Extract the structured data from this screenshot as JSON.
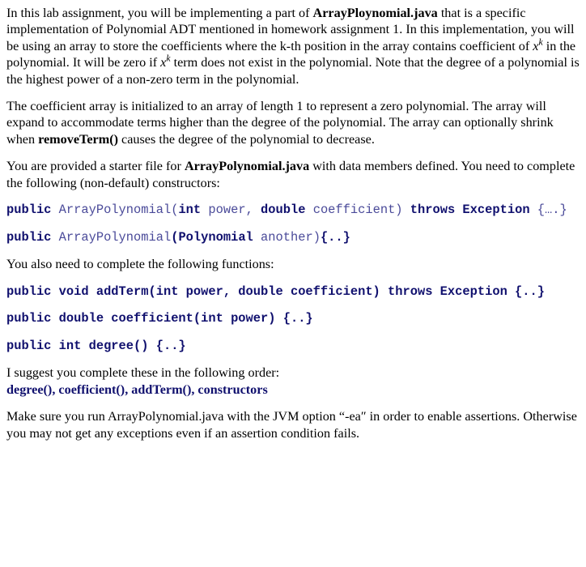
{
  "document": {
    "paragraph_1": {
      "part_1": "In this lab assignment, you will be implementing a part of ",
      "emphasis_1": "ArrayPloynomial.java",
      "part_2": " that is a specific implementation of Polynomial ADT mentioned in homework assignment 1. In this implementation, you will be using an array to store the coefficients where the k-th position in the array contains coefficient of ",
      "math_1_base": "x",
      "math_1_exp": "k",
      "part_3": " in the polynomial. It will be zero if ",
      "math_2_base": "x",
      "math_2_exp": "k",
      "part_4": " term does not exist in the polynomial. Note that the degree of a polynomial is the highest power of a non-zero term in the polynomial."
    },
    "paragraph_2": {
      "part_1": "The coefficient array is initialized to an array of length 1 to represent a zero polynomial. The array will expand to accommodate terms higher than the degree of the polynomial. The array can optionally shrink when ",
      "emphasis_1": "removeTerm()",
      "part_2": " causes the degree of the polynomial to decrease."
    },
    "paragraph_3": {
      "part_1": "You are provided a starter file for ",
      "emphasis_1": "ArrayPolynomial.java",
      "part_2": " with data members defined. You need to complete the following (non-default) constructors:"
    },
    "code_1": {
      "seg_1": "public",
      "seg_2": " ArrayPolynomial(",
      "seg_3": "int",
      "seg_4": " power, ",
      "seg_5": "double",
      "seg_6": " coefficient) ",
      "seg_7": "throws Exception",
      "seg_8": " {….}"
    },
    "code_2": {
      "seg_1": "public",
      "seg_2": " ArrayPolynomial",
      "seg_3": "(Polynomial",
      "seg_4": " another)",
      "seg_5": "{..}"
    },
    "paragraph_4": {
      "part_1": "You also need to complete the following functions:"
    },
    "code_3": {
      "seg_1": "public void addTerm(int power, double coefficient) throws Exception {..}"
    },
    "code_4": {
      "seg_1": "public double coefficient(int power) {..}"
    },
    "code_5": {
      "seg_1": "public int degree() {..}"
    },
    "paragraph_5": {
      "part_1": "I suggest you complete these in the following order:"
    },
    "code_6": {
      "seg_1": "degree(), coefficient(), addTerm(), constructors"
    },
    "paragraph_6": {
      "part_1": "Make sure you run ArrayPolynomial.java with the JVM option “-ea″  in order to enable assertions. Otherwise you may not get any exceptions even if an assertion condition fails."
    }
  }
}
